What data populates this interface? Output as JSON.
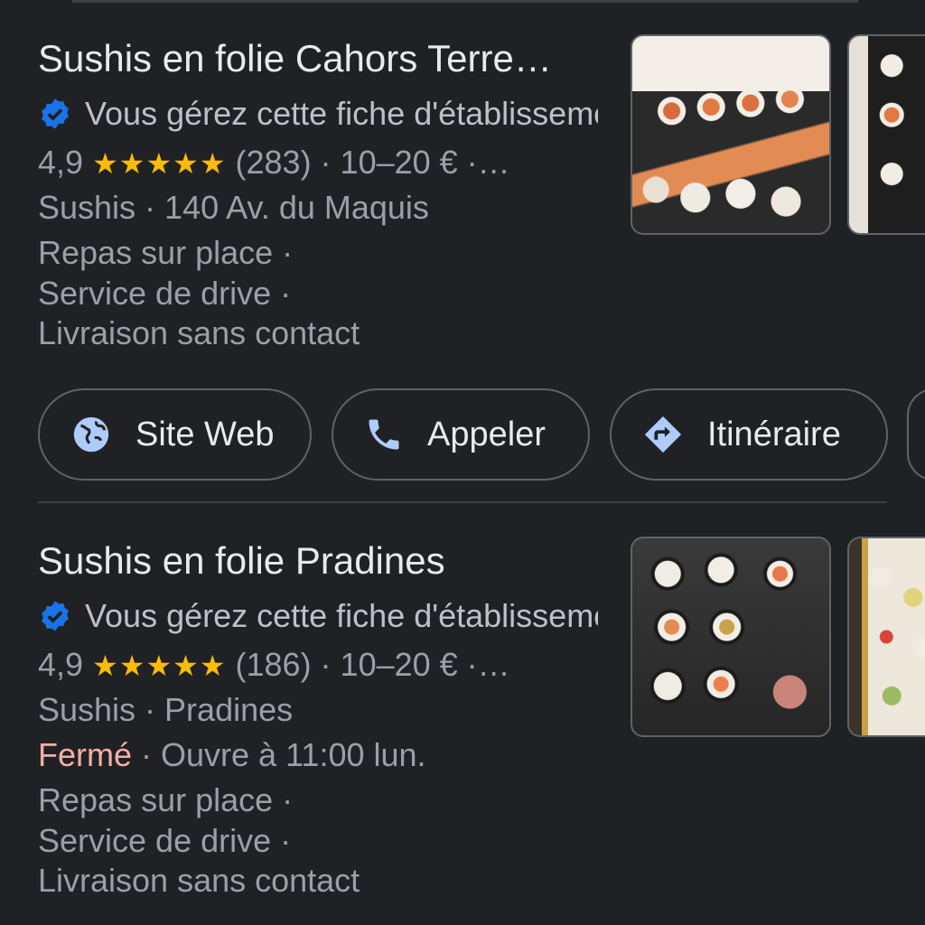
{
  "listings": [
    {
      "name": "Sushis en folie Cahors Terre…",
      "managed_text": "Vous gérez cette fiche d'établissement",
      "rating": "4,9",
      "stars": "★★★★★",
      "rating_rest": "(283) · 10–20 € ·…",
      "category_address": "Sushis · 140 Av. du Maquis",
      "services": [
        "Repas sur place ·",
        "Service de drive ·",
        "Livraison sans contact"
      ],
      "has_video_thumb": true
    },
    {
      "name": "Sushis en folie Pradines",
      "managed_text": "Vous gérez cette fiche d'établissement",
      "rating": "4,9",
      "stars": "★★★★★",
      "rating_rest": "(186) · 10–20 € ·…",
      "category_address": "Sushis · Pradines",
      "status_closed": "Fermé",
      "status_rest": " · Ouvre à 11:00 lun.",
      "services": [
        "Repas sur place ·",
        "Service de drive ·",
        "Livraison sans contact"
      ]
    }
  ],
  "actions": {
    "website": "Site Web",
    "call": "Appeler",
    "directions": "Itinéraire"
  },
  "colors": {
    "background": "#202124",
    "text_primary": "#e8eaed",
    "text_secondary": "#9aa0a6",
    "stars": "#fbbc04",
    "verified": "#1a73e8",
    "closed": "#f6aea9",
    "action_icon": "#aecbfa"
  },
  "icons": {
    "verified": "verified-badge-icon",
    "website": "globe-icon",
    "call": "phone-icon",
    "directions": "directions-icon",
    "video": "play-icon"
  }
}
